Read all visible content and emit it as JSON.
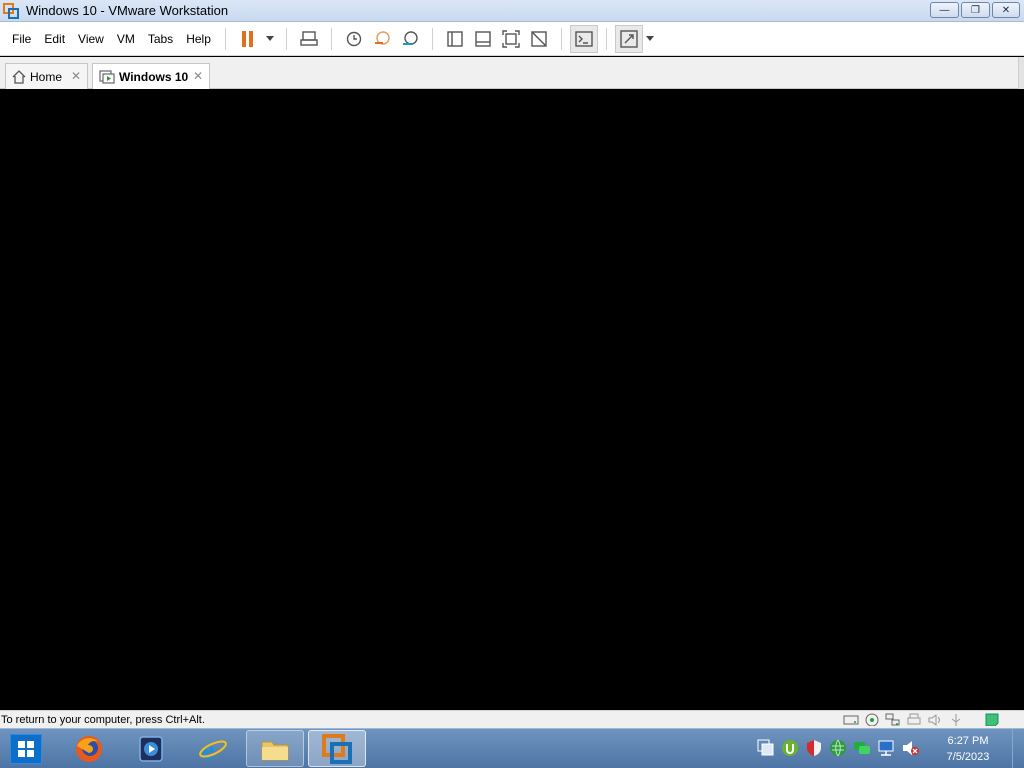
{
  "window": {
    "title": "Windows 10 - VMware Workstation",
    "buttons": {
      "minimize": "—",
      "restore": "❐",
      "close": "✕"
    }
  },
  "menu": [
    "File",
    "Edit",
    "View",
    "VM",
    "Tabs",
    "Help"
  ],
  "toolbar": {
    "icons": [
      "pause-icon",
      "send-ctrl-alt-del-icon",
      "snapshot-take-icon",
      "snapshot-revert-icon",
      "snapshot-manager-icon",
      "library-view-icon",
      "thumbnail-bar-icon",
      "full-screen-icon",
      "unity-icon",
      "console-view-icon",
      "stretch-guest-icon"
    ],
    "accent": "#e07020"
  },
  "tabs": [
    {
      "label": "Home",
      "icon": "home-icon",
      "active": false
    },
    {
      "label": "Windows 10",
      "icon": "vm-icon",
      "active": true
    }
  ],
  "status": {
    "message": "To return to your computer, press Ctrl+Alt."
  },
  "taskbar": {
    "apps": [
      "firefox-icon",
      "media-player-icon",
      "internet-explorer-icon",
      "file-explorer-icon",
      "vmware-icon"
    ],
    "clock": {
      "time": "6:27 PM",
      "date": "7/5/2023"
    }
  }
}
